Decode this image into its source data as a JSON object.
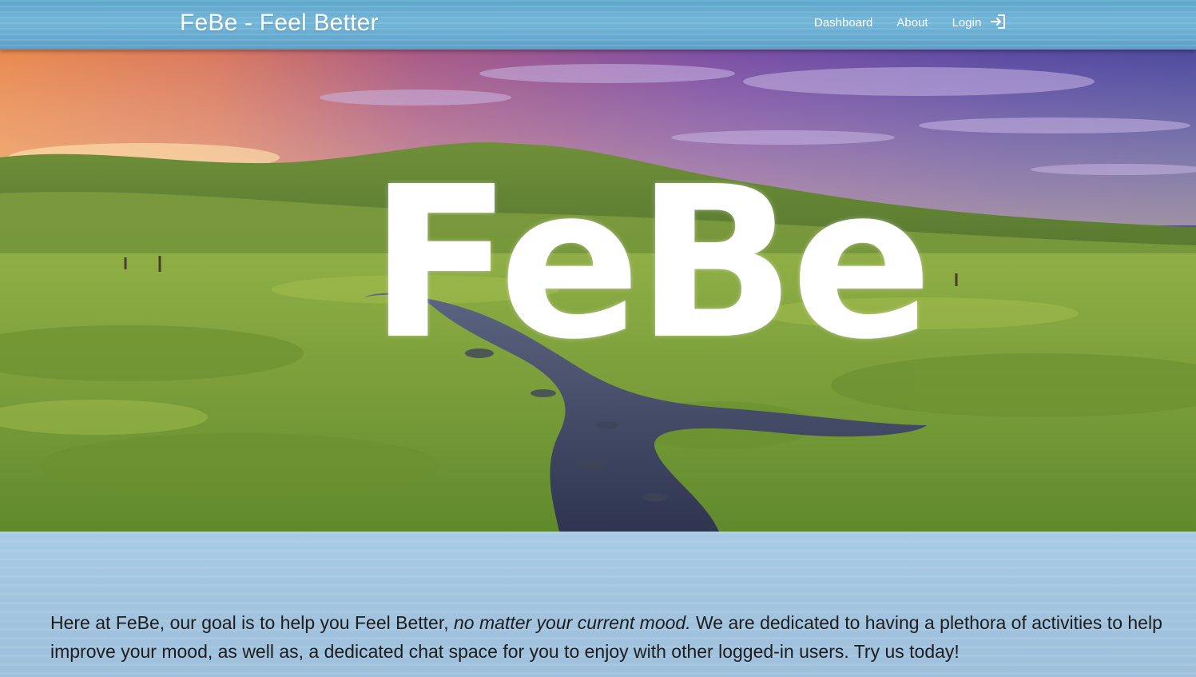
{
  "navbar": {
    "brand": "FeBe - Feel Better",
    "links": [
      {
        "label": "Dashboard"
      },
      {
        "label": "About"
      },
      {
        "label": "Login"
      }
    ],
    "login_icon": "login-arrow-icon"
  },
  "hero": {
    "logo_text": "FeBe",
    "background": "landscape-image"
  },
  "intro": {
    "part1": "Here at FeBe, our goal is to help you Feel Better, ",
    "emphasis": "no matter your current mood.",
    "part2": " We are dedicated to having a plethora of activities to help improve your mood, as well as, a dedicated chat space for you to enjoy with other logged-in users. Try us today!"
  },
  "colors": {
    "navbar": "#66abd1",
    "content_bg": "#a6c8e3",
    "text": "#1d1d1d"
  }
}
